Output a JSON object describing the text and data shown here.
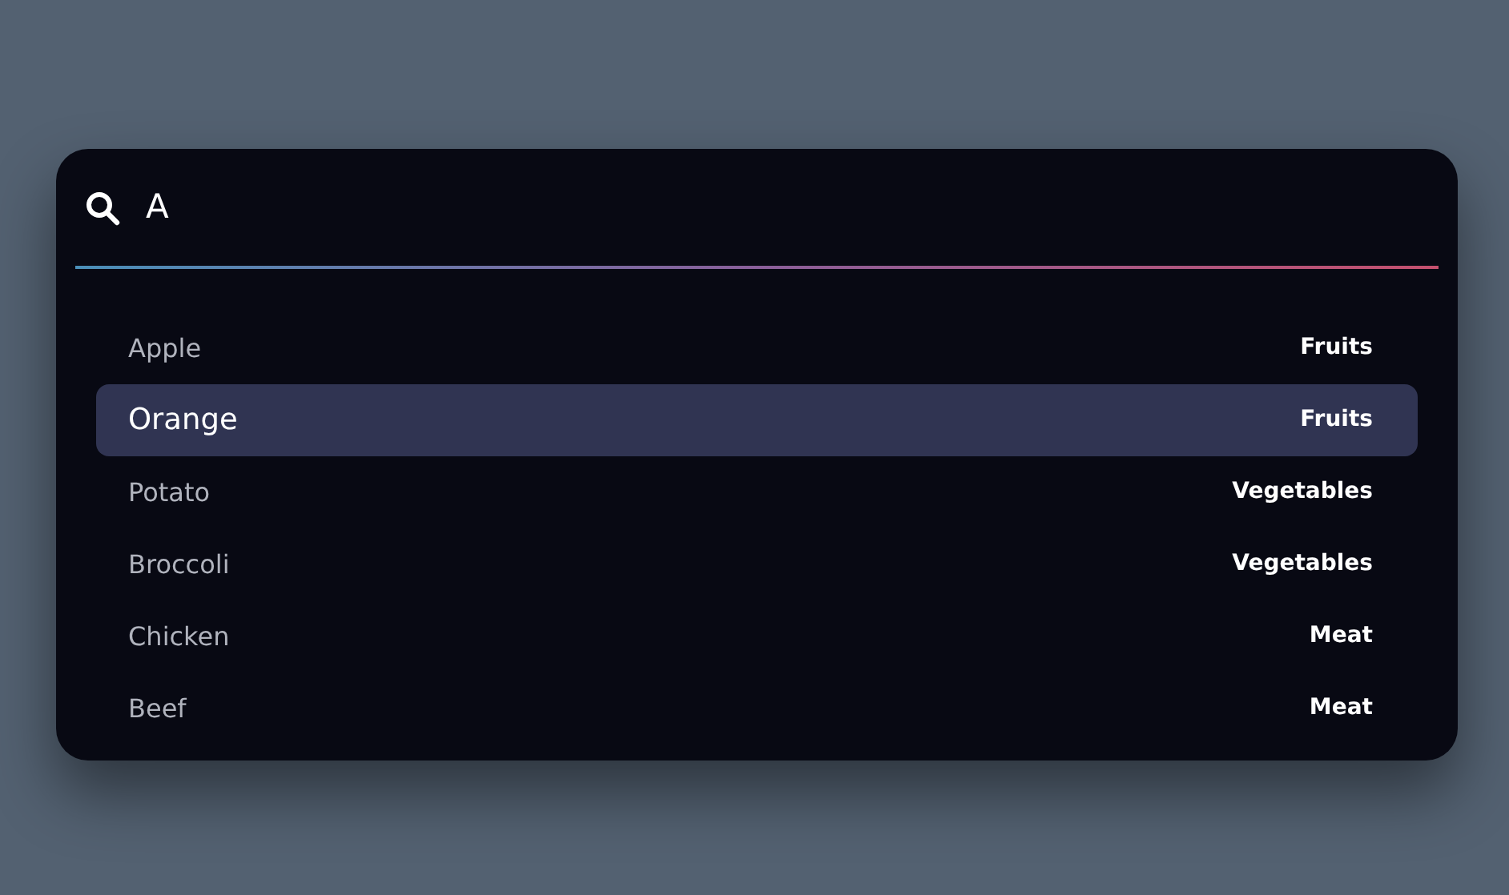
{
  "search": {
    "value": "A"
  },
  "results": [
    {
      "name": "Apple",
      "category": "Fruits",
      "selected": false
    },
    {
      "name": "Orange",
      "category": "Fruits",
      "selected": true
    },
    {
      "name": "Potato",
      "category": "Vegetables",
      "selected": false
    },
    {
      "name": "Broccoli",
      "category": "Vegetables",
      "selected": false
    },
    {
      "name": "Chicken",
      "category": "Meat",
      "selected": false
    },
    {
      "name": "Beef",
      "category": "Meat",
      "selected": false
    }
  ]
}
